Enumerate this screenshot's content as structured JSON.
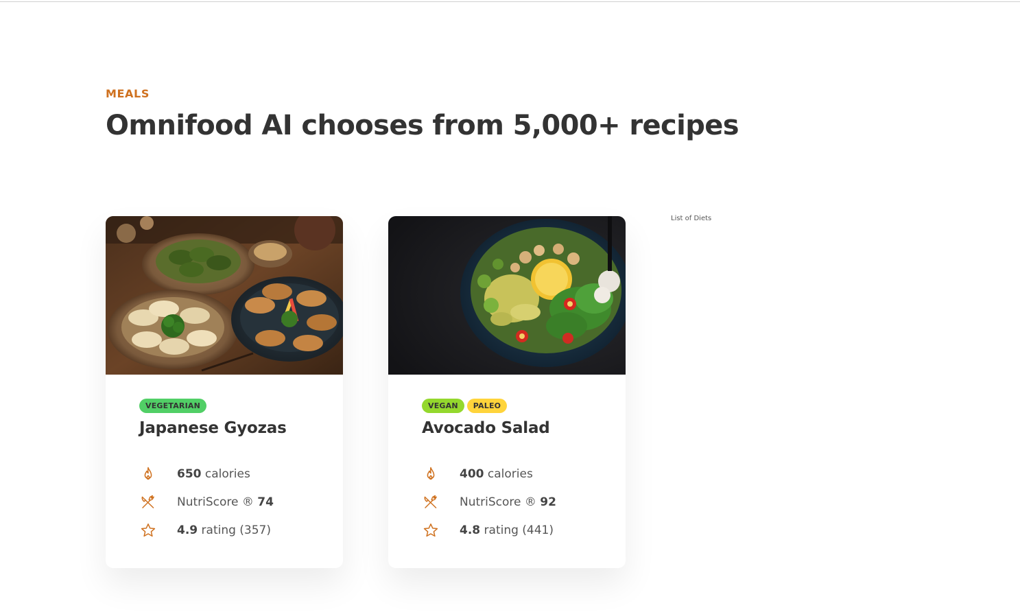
{
  "section": {
    "subheading": "Meals",
    "heading": "Omnifood AI chooses from 5,000+ recipes"
  },
  "meals": [
    {
      "image_icon": "dumplings-photo",
      "tags": [
        "Vegetarian"
      ],
      "title": "Japanese Gyozas",
      "calories_value": "650",
      "calories_label": "calories",
      "nutri_label": "NutriScore ®",
      "nutri_value": "74",
      "rating_value": "4.9",
      "rating_label": "rating (357)"
    },
    {
      "image_icon": "salad-bowl-photo",
      "tags": [
        "Vegan",
        "Paleo"
      ],
      "title": "Avocado Salad",
      "calories_value": "400",
      "calories_label": "calories",
      "nutri_label": "NutriScore ®",
      "nutri_value": "92",
      "rating_value": "4.8",
      "rating_label": "rating (441)"
    }
  ],
  "diets": {
    "label": "List of Diets"
  },
  "icons": {
    "calories": "flame-icon",
    "nutri": "restaurant-icon",
    "rating": "star-icon"
  },
  "colors": {
    "accent": "#cf711f",
    "tag_vegetarian": "#51cf66",
    "tag_vegan": "#94d82d",
    "tag_paleo": "#ffd43b",
    "heading": "#333333"
  }
}
